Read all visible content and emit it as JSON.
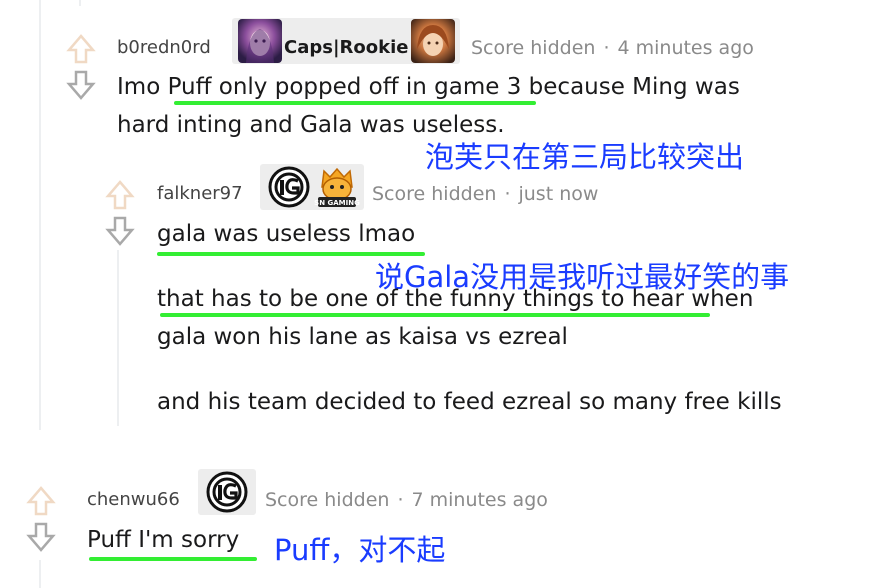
{
  "comments": [
    {
      "username": "b0redn0rd",
      "flair_text": "Caps|Rookie",
      "flair_icons": [
        "caps-avatar-icon",
        "rookie-avatar-icon"
      ],
      "score": "Score hidden",
      "time": "4 minutes ago",
      "body_lines": [
        "Imo Puff only popped off in game 3 because Ming was",
        "hard inting and Gala was useless."
      ],
      "annotation": "泡芙只在第三局比较突出"
    },
    {
      "username": "falkner97",
      "flair_icons": [
        "ig-logo-icon",
        "sn-gaming-logo-icon"
      ],
      "sn_logo_text": "SN GAMING",
      "score": "Score hidden",
      "time": "just now",
      "body_paragraphs": [
        "gala was useless lmao",
        "that has to be one of the funny things to hear when",
        "gala won his lane as kaisa vs ezreal",
        "and his team decided to feed ezreal so many free kills"
      ],
      "annotation": "说Gala没用是我听过最好笑的事"
    },
    {
      "username": "chenwu66",
      "flair_icons": [
        "ig-logo-icon"
      ],
      "score": "Score hidden",
      "time": "7 minutes ago",
      "body": "Puff I'm sorry",
      "annotation": "Puff，对不起"
    }
  ],
  "meta_separator": "·",
  "colors": {
    "highlight_underline": "#33ee33",
    "annotation_blue": "#1a3cff",
    "upvote_arrow": "#f0d9c4",
    "downvote_arrow": "#a9a9a9"
  }
}
